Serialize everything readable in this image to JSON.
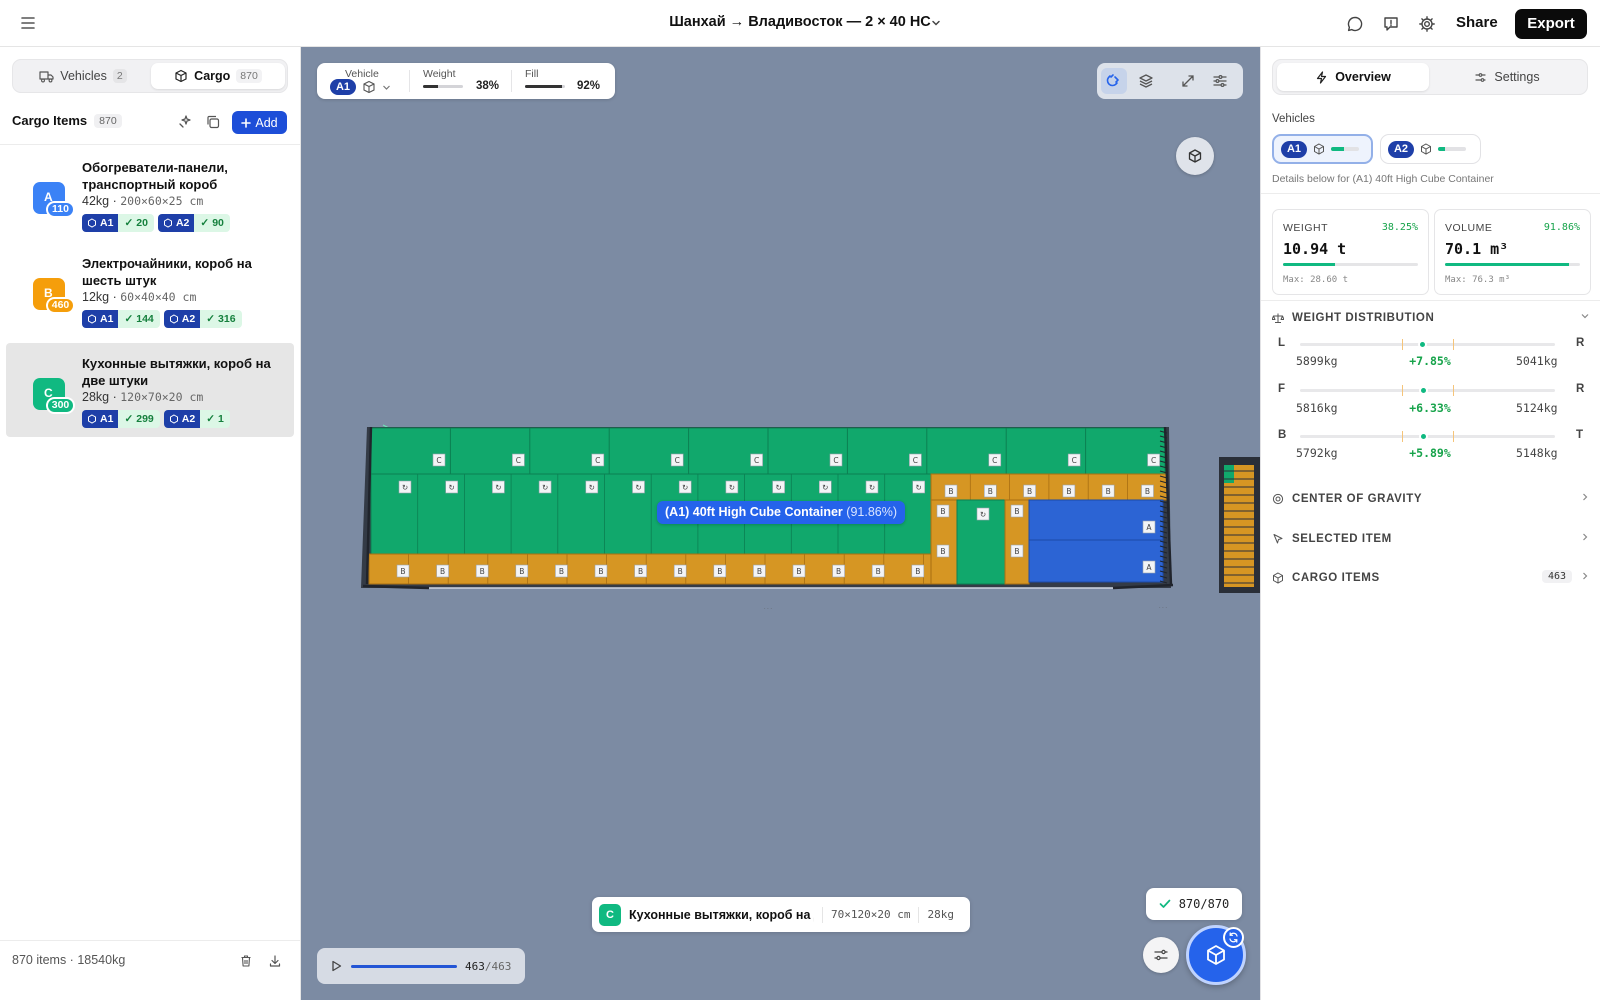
{
  "header": {
    "title": "Шанхай → Владивосток — 2 × 40 HC",
    "share_label": "Share",
    "export_label": "Export"
  },
  "left": {
    "tabs": [
      {
        "label": "Vehicles",
        "count": "2"
      },
      {
        "label": "Cargo",
        "count": "870"
      }
    ],
    "heading": "Cargo Items",
    "heading_count": "870",
    "add_label": "Add",
    "items": [
      {
        "letter": "A",
        "qty": "110",
        "color": "#3b82f6",
        "name": "Обогреватели-панели, транспортный короб",
        "weight": "42kg",
        "dims": "200×60×25 cm",
        "chips": [
          {
            "vehicle": "A1",
            "count": "20"
          },
          {
            "vehicle": "A2",
            "count": "90"
          }
        ]
      },
      {
        "letter": "B",
        "qty": "460",
        "color": "#f59e0b",
        "name": "Электрочайники, короб на шесть штук",
        "weight": "12kg",
        "dims": "60×40×40 cm",
        "chips": [
          {
            "vehicle": "A1",
            "count": "144"
          },
          {
            "vehicle": "A2",
            "count": "316"
          }
        ]
      },
      {
        "letter": "C",
        "qty": "300",
        "color": "#10b981",
        "name": "Кухонные вытяжки, короб на две штуки",
        "weight": "28kg",
        "dims": "120×70×20 cm",
        "chips": [
          {
            "vehicle": "A1",
            "count": "299"
          },
          {
            "vehicle": "A2",
            "count": "1"
          }
        ]
      }
    ],
    "footer": {
      "items": "870 items",
      "weight": "18540kg"
    }
  },
  "canvas": {
    "stats": {
      "vehicle_label": "Vehicle",
      "vehicle": "A1",
      "weight_label": "Weight",
      "weight_value": "38%",
      "weight_fraction": 0.38,
      "fill_label": "Fill",
      "fill_value": "92%",
      "fill_fraction": 0.92
    },
    "container_tag": "(A1) 40ft High Cube Container",
    "container_pct": "(91.86%)",
    "selected": {
      "letter": "C",
      "name": "Кухонные вытяжки, короб на две штуки",
      "dims": "70×120×20 cm",
      "weight": "28kg"
    },
    "done": "870/870",
    "player": {
      "current": "463",
      "total": "/463",
      "fraction": 1.0
    }
  },
  "right": {
    "tabs": [
      {
        "label": "Overview"
      },
      {
        "label": "Settings"
      }
    ],
    "vehicles_label": "Vehicles",
    "vehicles": [
      {
        "name": "A1",
        "fill_fraction": 0.45
      },
      {
        "name": "A2",
        "fill_fraction": 0.25
      }
    ],
    "details_note": "Details below for (A1) 40ft High Cube Container",
    "weight_card": {
      "label": "WEIGHT",
      "pct": "38.25%",
      "value": "10.94 t",
      "max": "Max: 28.60 t",
      "fraction": 0.3825
    },
    "volume_card": {
      "label": "VOLUME",
      "pct": "91.86%",
      "value": "70.1 m³",
      "max": "Max: 76.3 m³",
      "fraction": 0.9186
    },
    "weight_distribution": {
      "title": "WEIGHT DISTRIBUTION",
      "rows": [
        {
          "left": "L",
          "right": "R",
          "left_kg": "5899kg",
          "delta": "+7.85%",
          "right_kg": "5041kg",
          "balance": 0.478
        },
        {
          "left": "F",
          "right": "R",
          "left_kg": "5816kg",
          "delta": "+6.33%",
          "right_kg": "5124kg",
          "balance": 0.484
        },
        {
          "left": "B",
          "right": "T",
          "left_kg": "5792kg",
          "delta": "+5.89%",
          "right_kg": "5148kg",
          "balance": 0.484
        }
      ]
    },
    "sections": [
      {
        "title": "CENTER OF GRAVITY",
        "icon": "target-icon"
      },
      {
        "title": "SELECTED ITEM",
        "icon": "cursor-icon"
      },
      {
        "title": "CARGO ITEMS",
        "icon": "box-icon",
        "count": "463"
      }
    ]
  }
}
